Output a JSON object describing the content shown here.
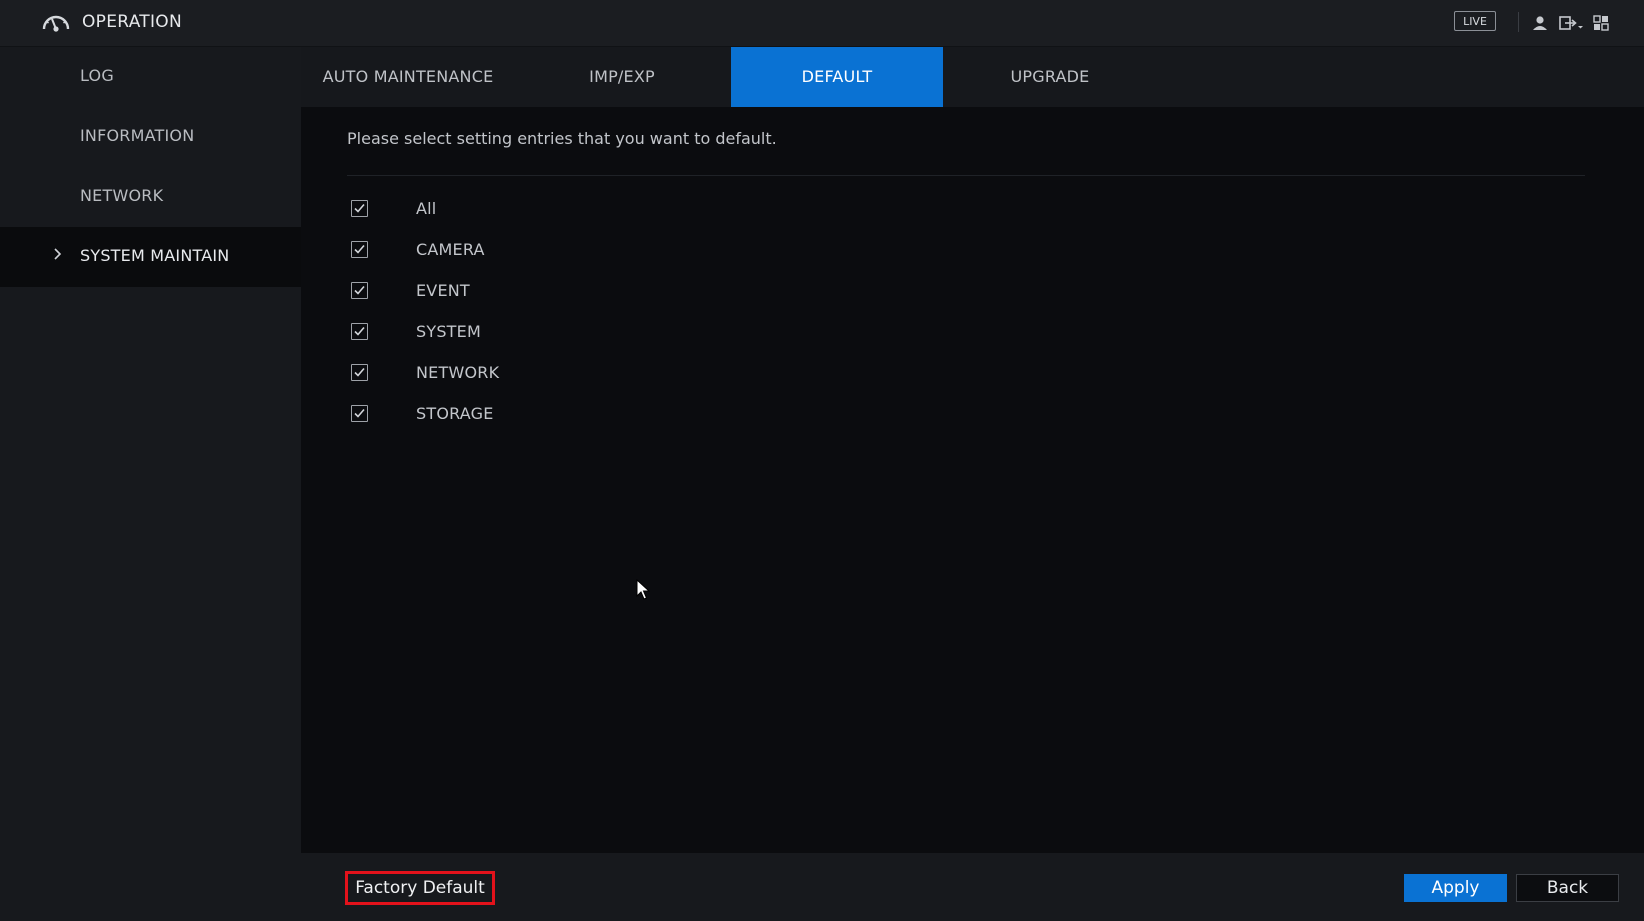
{
  "header": {
    "title": "OPERATION",
    "logo_icon": "gauge-icon",
    "live_label": "LIVE",
    "icons": [
      "user-icon",
      "logout-icon",
      "grid-icon"
    ]
  },
  "sidebar": {
    "items": [
      {
        "label": "LOG",
        "active": false
      },
      {
        "label": "INFORMATION",
        "active": false
      },
      {
        "label": "NETWORK",
        "active": false
      },
      {
        "label": "SYSTEM MAINTAIN",
        "active": true
      }
    ]
  },
  "tabs": [
    {
      "label": "AUTO MAINTENANCE",
      "active": false
    },
    {
      "label": "IMP/EXP",
      "active": false
    },
    {
      "label": "DEFAULT",
      "active": true
    },
    {
      "label": "UPGRADE",
      "active": false
    }
  ],
  "main": {
    "instruction": "Please select setting entries that you want to default.",
    "options": [
      {
        "label": "All",
        "checked": true
      },
      {
        "label": "CAMERA",
        "checked": true
      },
      {
        "label": "EVENT",
        "checked": true
      },
      {
        "label": "SYSTEM",
        "checked": true
      },
      {
        "label": "NETWORK",
        "checked": true
      },
      {
        "label": "STORAGE",
        "checked": true
      }
    ]
  },
  "footer": {
    "factory_default_label": "Factory Default",
    "apply_label": "Apply",
    "back_label": "Back"
  },
  "colors": {
    "accent": "#0a72d3",
    "highlight_border": "#e2121b"
  }
}
